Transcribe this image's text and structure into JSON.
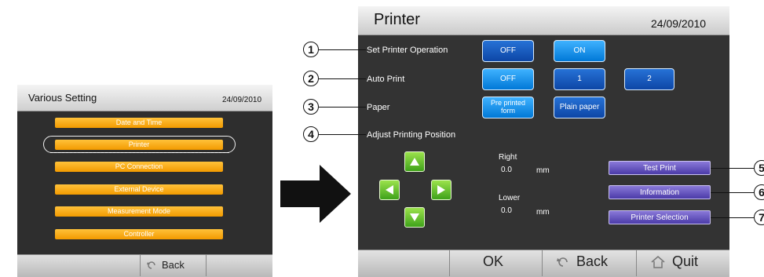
{
  "left_screen": {
    "title": "Various Setting",
    "date": "24/09/2010",
    "menu": [
      "Date and Time",
      "Printer",
      "PC Connection",
      "External Device",
      "Measurement Mode",
      "Controller"
    ],
    "back_label": "Back"
  },
  "right_screen": {
    "title": "Printer",
    "date": "24/09/2010",
    "rows": {
      "set_printer_operation": "Set Printer Operation",
      "auto_print": "Auto Print",
      "paper": "Paper",
      "adjust_printing_position": "Adjust Printing Position"
    },
    "buttons": {
      "operation_off": "OFF",
      "operation_on": "ON",
      "auto_off": "OFF",
      "auto_1": "1",
      "auto_2": "2",
      "paper_preprinted_line1": "Pre printed",
      "paper_preprinted_line2": "form",
      "paper_plain": "Plain paper",
      "test_print": "Test Print",
      "information": "Information",
      "printer_selection": "Printer Selection"
    },
    "position": {
      "right_label": "Right",
      "right_value": "0.0",
      "right_unit": "mm",
      "lower_label": "Lower",
      "lower_value": "0.0",
      "lower_unit": "mm"
    },
    "footer": {
      "ok": "OK",
      "back": "Back",
      "quit": "Quit"
    }
  },
  "callouts": [
    "1",
    "2",
    "3",
    "4",
    "5",
    "6",
    "7"
  ],
  "colors": {
    "orange": "#f39a00",
    "blue": "#0078d7",
    "purple": "#4b3ba8",
    "green": "#3fa21a"
  }
}
